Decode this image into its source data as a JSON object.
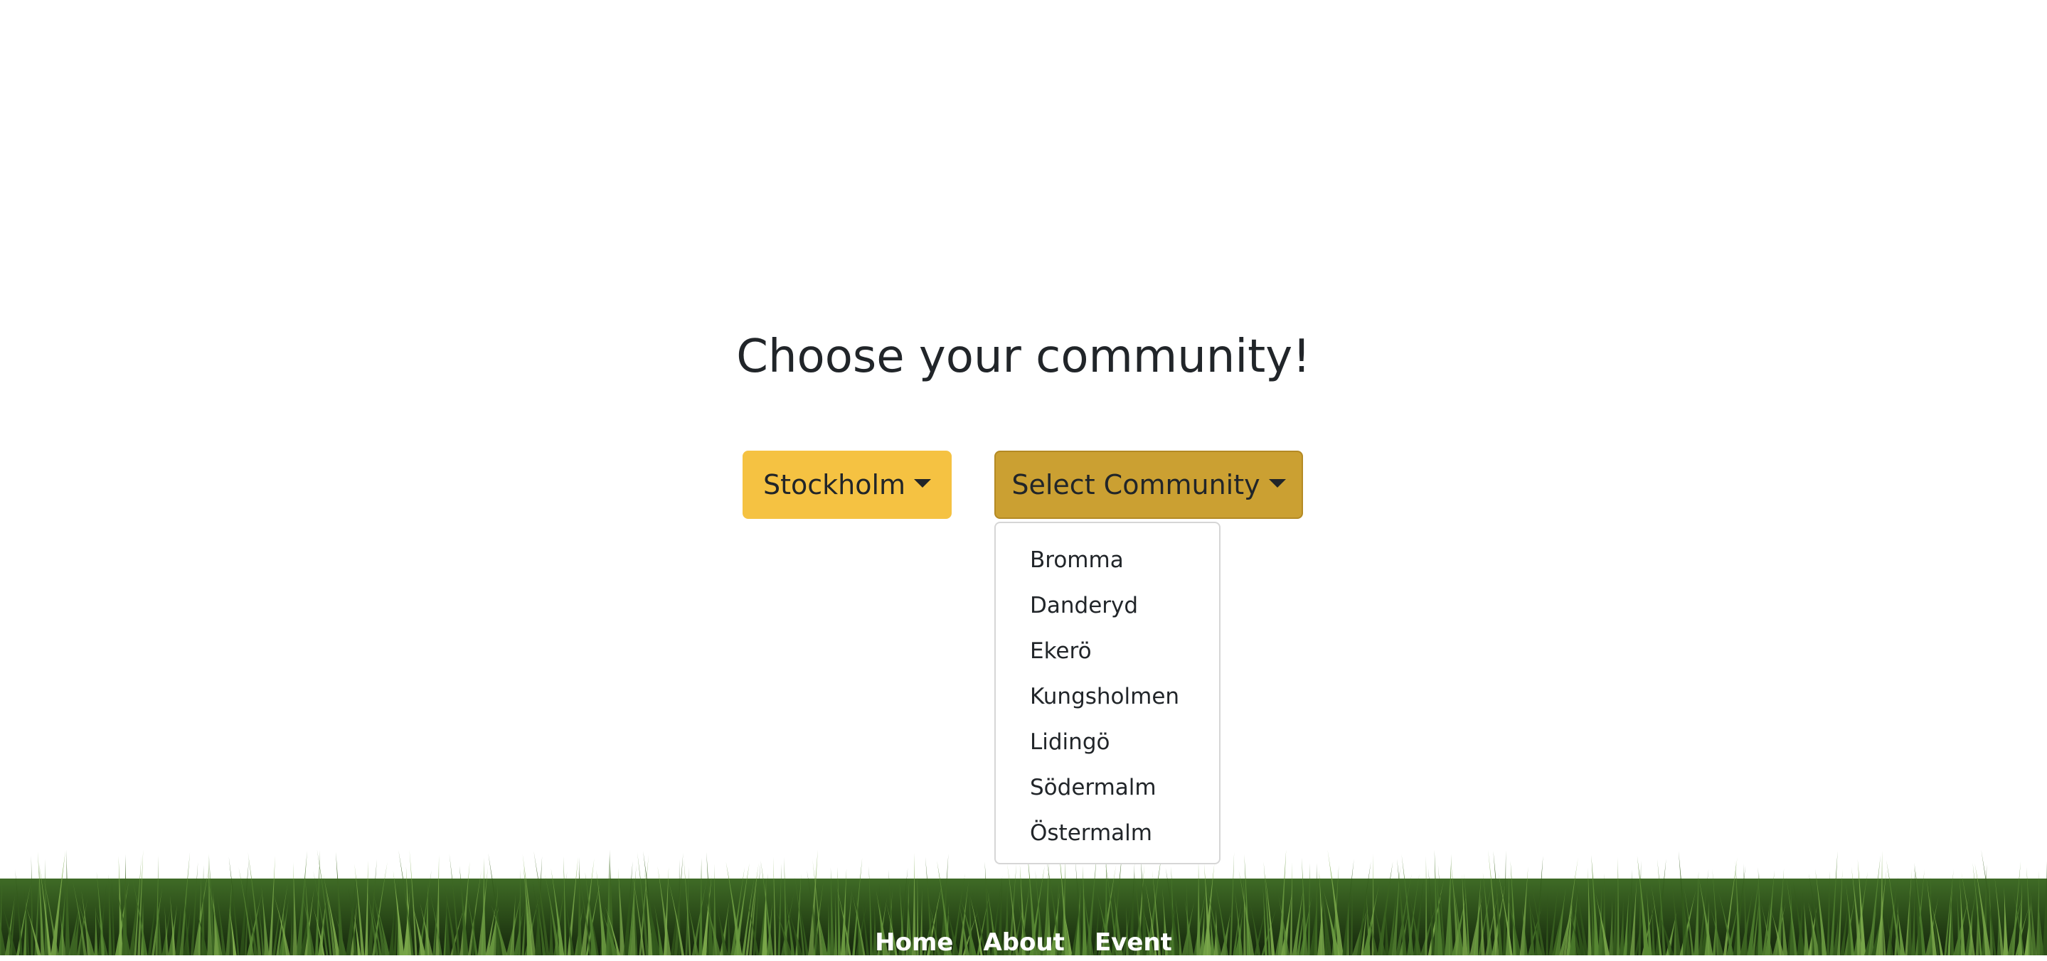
{
  "page": {
    "title": "Choose your community!"
  },
  "city_dropdown": {
    "label": "Stockholm",
    "color": "#f5c242"
  },
  "community_dropdown": {
    "label": "Select Community",
    "color": "#cba032",
    "options": [
      "Bromma",
      "Danderyd",
      "Ekerö",
      "Kungsholmen",
      "Lidingö",
      "Södermalm",
      "Östermalm"
    ]
  },
  "footer": {
    "links": [
      "Home",
      "About",
      "Event"
    ]
  }
}
